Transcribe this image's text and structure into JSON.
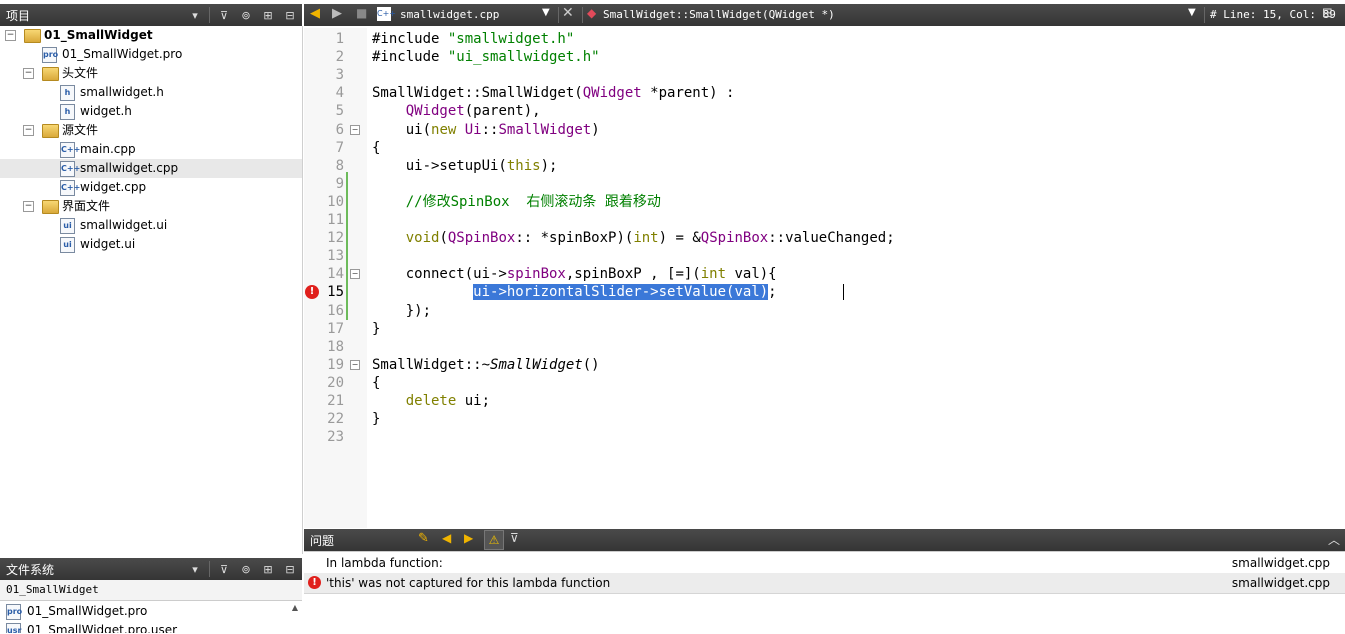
{
  "project_panel": {
    "title": "项目",
    "tree": [
      {
        "label": "01_SmallWidget",
        "level": 0,
        "kind": "project",
        "expanded": true,
        "bold": true
      },
      {
        "label": "01_SmallWidget.pro",
        "level": 1,
        "kind": "pro"
      },
      {
        "label": "头文件",
        "level": 1,
        "kind": "folder",
        "expanded": true
      },
      {
        "label": "smallwidget.h",
        "level": 2,
        "kind": "h"
      },
      {
        "label": "widget.h",
        "level": 2,
        "kind": "h"
      },
      {
        "label": "源文件",
        "level": 1,
        "kind": "folder",
        "expanded": true
      },
      {
        "label": "main.cpp",
        "level": 2,
        "kind": "cpp"
      },
      {
        "label": "smallwidget.cpp",
        "level": 2,
        "kind": "cpp",
        "selected": true
      },
      {
        "label": "widget.cpp",
        "level": 2,
        "kind": "cpp"
      },
      {
        "label": "界面文件",
        "level": 1,
        "kind": "folder",
        "expanded": true
      },
      {
        "label": "smallwidget.ui",
        "level": 2,
        "kind": "ui"
      },
      {
        "label": "widget.ui",
        "level": 2,
        "kind": "ui"
      }
    ]
  },
  "filesystem_panel": {
    "title": "文件系统",
    "path": "01_SmallWidget",
    "items": [
      "01_SmallWidget.pro",
      "01_SmallWidget.pro.user"
    ]
  },
  "editor": {
    "file_name": "smallwidget.cpp",
    "symbol": "SmallWidget::SmallWidget(QWidget *)",
    "position": "#  Line: 15, Col: 89",
    "current_line": 15,
    "lines": [
      "#include \"smallwidget.h\"",
      "#include \"ui_smallwidget.h\"",
      "",
      "SmallWidget::SmallWidget(QWidget *parent) :",
      "    QWidget(parent),",
      "    ui(new Ui::SmallWidget)",
      "{",
      "    ui->setupUi(this);",
      "",
      "    //修改SpinBox  右侧滚动条 跟着移动",
      "",
      "    void(QSpinBox:: *spinBoxP)(int) = &QSpinBox::valueChanged;",
      "",
      "    connect(ui->spinBox,spinBoxP , [=](int val){",
      "            ui->horizontalSlider->setValue(val);",
      "    });",
      "}",
      "",
      "SmallWidget::~SmallWidget()",
      "{",
      "    delete ui;",
      "}",
      ""
    ]
  },
  "issues_panel": {
    "title": "问题",
    "rows": [
      {
        "text": "In lambda function:",
        "file": "smallwidget.cpp",
        "error": false
      },
      {
        "text": "'this' was not captured for this lambda function",
        "file": "smallwidget.cpp",
        "error": true
      }
    ]
  },
  "colors": {
    "selection": "#3b78d8",
    "error": "#e0201c",
    "keyword": "#808000",
    "string": "#008000",
    "class": "#800080"
  }
}
